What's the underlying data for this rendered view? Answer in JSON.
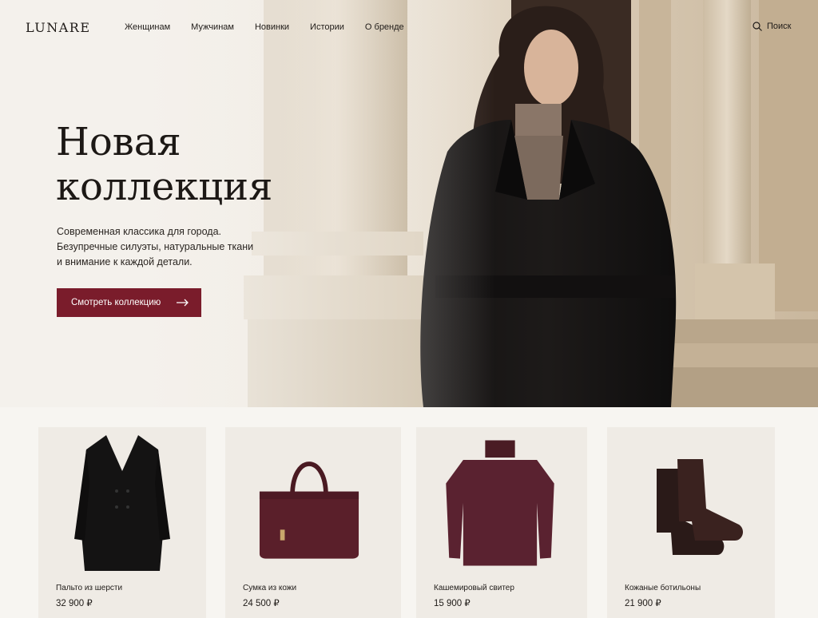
{
  "brand": "LUNARE",
  "nav": {
    "items": [
      "Женщинам",
      "Мужчинам",
      "Новинки",
      "Истории",
      "О бренде"
    ]
  },
  "search": {
    "label": "Поиск",
    "icon": "search-icon"
  },
  "hero": {
    "title_line1": "Новая",
    "title_line2": "коллекция",
    "subtitle_line1": "Современная классика для города.",
    "subtitle_line2": "Безупречные силуэты, натуральные ткани",
    "subtitle_line3": "и внимание к каждой детали.",
    "cta_label": "Смотреть коллекцию",
    "cta_icon": "arrow-right-icon"
  },
  "products": [
    {
      "name": "Пальто из шерсти",
      "price": "32 900 ₽",
      "icon": "coat-image"
    },
    {
      "name": "Сумка из кожи",
      "price": "24 500 ₽",
      "icon": "bag-image"
    },
    {
      "name": "Кашемировый свитер",
      "price": "15 900 ₽",
      "icon": "sweater-image"
    },
    {
      "name": "Кожаные ботильоны",
      "price": "21 900 ₽",
      "icon": "boots-image"
    }
  ],
  "colors": {
    "accent": "#7a1c2b",
    "text": "#1f1b18",
    "background": "#f6f4f0",
    "card": "#efebe5"
  }
}
